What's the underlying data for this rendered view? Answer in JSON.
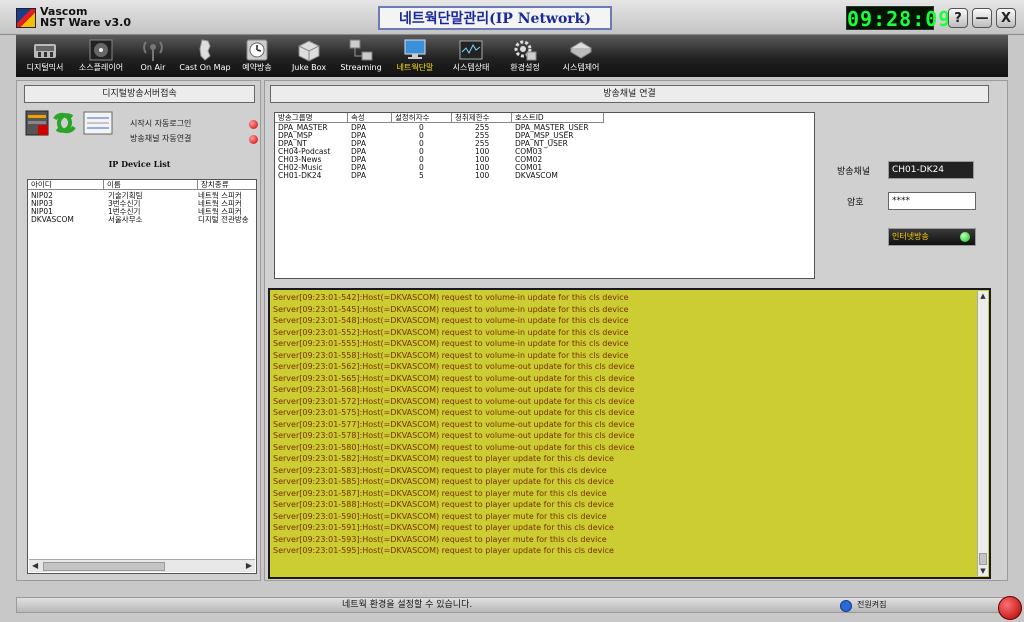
{
  "app": {
    "brand": "Vascom",
    "product": "NST Ware v3.0"
  },
  "page_title": "네트웍단말관리(IP Network)",
  "clock": "09:28:09",
  "window_buttons": {
    "help": "?",
    "minimize": "—",
    "close": "X"
  },
  "toolbar": [
    {
      "label": "디지털믹서",
      "icon": "mixer-icon"
    },
    {
      "label": "소스플레이어",
      "icon": "source-player-icon"
    },
    {
      "label": "On Air",
      "icon": "on-air-icon"
    },
    {
      "label": "Cast On Map",
      "icon": "cast-on-map-icon"
    },
    {
      "label": "예약방송",
      "icon": "reservation-clock-icon"
    },
    {
      "label": "Juke Box",
      "icon": "jukebox-icon"
    },
    {
      "label": "Streaming",
      "icon": "streaming-icon"
    },
    {
      "label": "네트웍단말",
      "icon": "network-terminal-icon",
      "active": true
    },
    {
      "label": "시스템상태",
      "icon": "system-status-icon"
    },
    {
      "label": "환경설정",
      "icon": "settings-gear-icon"
    },
    {
      "label": "시스템제어",
      "icon": "system-control-icon"
    }
  ],
  "left_panel": {
    "header": "디지털방송서버접속",
    "options": [
      "시작시 자동로그인",
      "방송채널 자동연결"
    ],
    "device_list_title": "IP Device List",
    "columns": [
      "아이디",
      "이름",
      "장치종류"
    ],
    "devices": [
      [
        "NIP02",
        "기술기획팀",
        "네트웍 스피커"
      ],
      [
        "NIP03",
        "3번수신기",
        "네트웍 스피커"
      ],
      [
        "NIP01",
        "1번수신기",
        "네트웍 스피커"
      ],
      [
        "DKVASCOM",
        "서울사무소",
        "디지털 전관방송"
      ]
    ]
  },
  "right_panel": {
    "header": "방송채널 연결",
    "columns": [
      "방송그룹명",
      "속성",
      "설정허자수",
      "청취제한수",
      "호스트ID"
    ],
    "groups": [
      [
        "DPA_MASTER",
        "DPA",
        "0",
        "255",
        "DPA_MASTER_USER"
      ],
      [
        "DPA_MSP",
        "DPA",
        "0",
        "255",
        "DPA_MSP_USER"
      ],
      [
        "DPA_NT",
        "DPA",
        "0",
        "255",
        "DPA_NT_USER"
      ],
      [
        "CH04-Podcast",
        "DPA",
        "0",
        "100",
        "COM03"
      ],
      [
        "CH03-News",
        "DPA",
        "0",
        "100",
        "COM02"
      ],
      [
        "CH02-Music",
        "DPA",
        "0",
        "100",
        "COM01"
      ],
      [
        "CH01-DK24",
        "DPA",
        "5",
        "100",
        "DKVASCOM"
      ]
    ],
    "channel_label": "방송채널",
    "channel_value": "CH01-DK24",
    "password_label": "암호",
    "password_value": "****",
    "internet_button": "인터넷방송"
  },
  "log": [
    "Server[09:23:01-542]:Host(=DKVASCOM) request to volume-in update for this cls device",
    "Server[09:23:01-545]:Host(=DKVASCOM) request to volume-in update for this cls device",
    "Server[09:23:01-548]:Host(=DKVASCOM) request to volume-in update for this cls device",
    "Server[09:23:01-552]:Host(=DKVASCOM) request to volume-in update for this cls device",
    "Server[09:23:01-555]:Host(=DKVASCOM) request to volume-in update for this cls device",
    "Server[09:23:01-558]:Host(=DKVASCOM) request to volume-in update for this cls device",
    "Server[09:23:01-562]:Host(=DKVASCOM) request to volume-out update for this cls device",
    "Server[09:23:01-565]:Host(=DKVASCOM) request to volume-out update for this cls device",
    "Server[09:23:01-568]:Host(=DKVASCOM) request to volume-out update for this cls device",
    "Server[09:23:01-572]:Host(=DKVASCOM) request to volume-out update for this cls device",
    "Server[09:23:01-575]:Host(=DKVASCOM) request to volume-out update for this cls device",
    "Server[09:23:01-577]:Host(=DKVASCOM) request to volume-out update for this cls device",
    "Server[09:23:01-578]:Host(=DKVASCOM) request to volume-out update for this cls device",
    "Server[09:23:01-580]:Host(=DKVASCOM) request to volume-out update for this cls device",
    "Server[09:23:01-582]:Host(=DKVASCOM) request to player update for this cls device",
    "Server[09:23:01-583]:Host(=DKVASCOM) request to player mute for this cls device",
    "Server[09:23:01-585]:Host(=DKVASCOM) request to player update for this cls device",
    "Server[09:23:01-587]:Host(=DKVASCOM) request to player mute for this cls device",
    "Server[09:23:01-588]:Host(=DKVASCOM) request to player update for this cls device",
    "Server[09:23:01-590]:Host(=DKVASCOM) request to player mute for this cls device",
    "Server[09:23:01-591]:Host(=DKVASCOM) request to player update for this cls device",
    "Server[09:23:01-593]:Host(=DKVASCOM) request to player mute for this cls device",
    "Server[09:23:01-595]:Host(=DKVASCOM) request to player update for this cls device"
  ],
  "status": {
    "message": "네트웍 환경을 설정할 수 있습니다.",
    "power_label": "전원켜짐"
  },
  "colors": {
    "log_background": "#cccc33",
    "log_text": "#7a2f00",
    "clock": "#19ff3a",
    "active_tool": "#ffe600"
  }
}
